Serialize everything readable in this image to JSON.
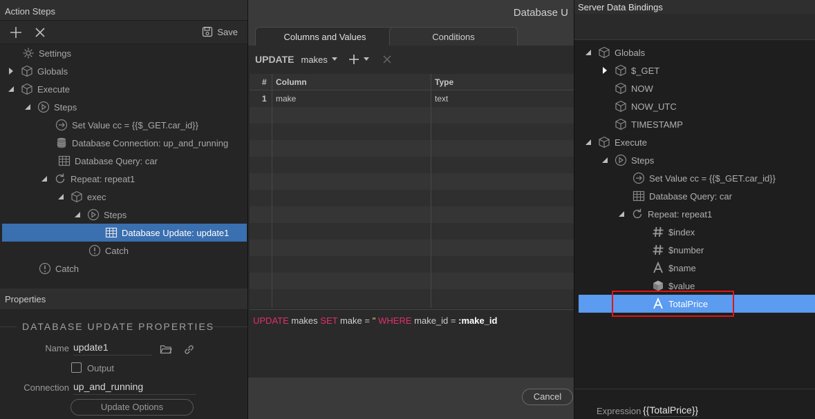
{
  "left_panel": {
    "title": "Action Steps",
    "toolbar": {
      "save_label": "Save",
      "add_icon": "plus-icon",
      "remove_icon": "close-icon",
      "save_icon": "save-icon"
    },
    "tree": [
      {
        "label": "Settings",
        "icon": "gear-icon"
      },
      {
        "label": "Globals",
        "icon": "cube-icon"
      },
      {
        "label": "Execute",
        "icon": "cube-icon"
      },
      {
        "label": "Steps",
        "icon": "play-circle-icon"
      },
      {
        "label": "Set Value cc = {{$_GET.car_id}}",
        "icon": "arrow-circle-icon"
      },
      {
        "label": "Database Connection: up_and_running",
        "icon": "database-icon"
      },
      {
        "label": "Database Query: car",
        "icon": "table-icon"
      },
      {
        "label": "Repeat: repeat1",
        "icon": "repeat-icon"
      },
      {
        "label": "exec",
        "icon": "cube-icon"
      },
      {
        "label": "Steps",
        "icon": "play-circle-icon"
      },
      {
        "label": "Database Update: update1",
        "icon": "table-icon"
      },
      {
        "label": "Catch",
        "icon": "alert-circle-icon"
      },
      {
        "label": "Catch",
        "icon": "alert-circle-icon"
      }
    ]
  },
  "properties": {
    "header": "Properties",
    "section_title": "DATABASE UPDATE PROPERTIES",
    "name_label": "Name",
    "name_value": "update1",
    "output_label": "Output",
    "connection_label": "Connection",
    "connection_value": "up_and_running",
    "update_options_label": "Update Options"
  },
  "dialog": {
    "title": "Database U",
    "tabs": [
      "Columns and Values",
      "Conditions"
    ],
    "update_keyword": "UPDATE",
    "table_name": "makes",
    "grid": {
      "headers": [
        "#",
        "Column",
        "Type"
      ],
      "rows": [
        {
          "num": "1",
          "column": "make",
          "type": "text"
        }
      ]
    },
    "sql": {
      "kw_update": "UPDATE",
      "table": " makes ",
      "kw_set": "SET",
      "assign": " make = ",
      "str": "''",
      "kw_where": " WHERE",
      "cond": " make_id = ",
      "param": ":make_id"
    },
    "cancel_label": "Cancel"
  },
  "right_panel": {
    "title": "Server Data Bindings",
    "tree": [
      {
        "label": "Globals",
        "icon": "cube-icon"
      },
      {
        "label": "$_GET",
        "icon": "cube-icon"
      },
      {
        "label": "NOW",
        "icon": "cube-icon"
      },
      {
        "label": "NOW_UTC",
        "icon": "cube-icon"
      },
      {
        "label": "TIMESTAMP",
        "icon": "cube-icon"
      },
      {
        "label": "Execute",
        "icon": "cube-icon"
      },
      {
        "label": "Steps",
        "icon": "play-circle-icon"
      },
      {
        "label": "Set Value cc = {{$_GET.car_id}}",
        "icon": "arrow-circle-icon"
      },
      {
        "label": "Database Query: car",
        "icon": "table-icon"
      },
      {
        "label": "Repeat: repeat1",
        "icon": "repeat-icon"
      },
      {
        "label": "$index",
        "icon": "hash-icon"
      },
      {
        "label": "$number",
        "icon": "hash-icon"
      },
      {
        "label": "$name",
        "icon": "text-a-icon"
      },
      {
        "label": "$value",
        "icon": "cube-filled-icon"
      },
      {
        "label": "TotalPrice",
        "icon": "text-a-icon"
      }
    ],
    "expression_label": "Expression",
    "expression_value": "{{TotalPrice}}"
  },
  "colors": {
    "selection_left": "#3a6fb0",
    "selection_right": "#5b9bf0",
    "highlight_box": "#e01515",
    "sql_keyword": "#e0306e",
    "sql_string": "#f0e070"
  }
}
